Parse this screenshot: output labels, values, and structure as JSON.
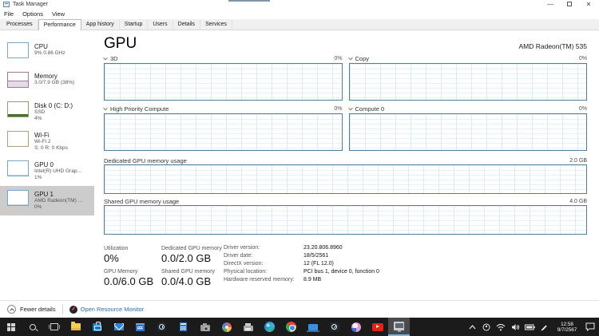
{
  "colors": {
    "accent_link": "#2b6cb5",
    "chart_border": "#4f7e99",
    "taskbar_bg": "#1b1b1b",
    "selected_sidebar_bg": "#cccccc",
    "active_app_underline": "#76b9ed"
  },
  "window": {
    "title": "Task Manager",
    "minimize": "—",
    "maximize": "",
    "close": "✕"
  },
  "menu": {
    "items": [
      {
        "label": "File"
      },
      {
        "label": "Options"
      },
      {
        "label": "View"
      }
    ]
  },
  "tabs": {
    "items": [
      {
        "label": "Processes"
      },
      {
        "label": "Performance"
      },
      {
        "label": "App history"
      },
      {
        "label": "Startup"
      },
      {
        "label": "Users"
      },
      {
        "label": "Details"
      },
      {
        "label": "Services"
      }
    ],
    "active": "Performance"
  },
  "sidebar": {
    "items": [
      {
        "title": "CPU",
        "line1": "9% 0.86 GHz"
      },
      {
        "title": "Memory",
        "line1": "3.0/7.9 GB (38%)"
      },
      {
        "title": "Disk 0 (C: D:)",
        "line1": "SSD",
        "line2": "4%"
      },
      {
        "title": "Wi-Fi",
        "line1": "Wi-Fi 2",
        "line2": "S: 0 R: 0 Kbps"
      },
      {
        "title": "GPU 0",
        "line1": "Intel(R) UHD Grap...",
        "line2": "1%"
      },
      {
        "title": "GPU 1",
        "line1": "AMD Radeon(TM) ...",
        "line2": "0%",
        "selected": true
      }
    ]
  },
  "main": {
    "title": "GPU",
    "subtitle": "AMD Radeon(TM) 535",
    "charts": [
      {
        "label": "3D",
        "value": "0%"
      },
      {
        "label": "Copy",
        "value": "0%"
      },
      {
        "label": "High Priority Compute",
        "value": "0%"
      },
      {
        "label": "Compute 0",
        "value": "0%"
      },
      {
        "label": "Dedicated GPU memory usage",
        "value": "2.0 GB"
      },
      {
        "label": "Shared GPU memory usage",
        "value": "4.0 GB"
      }
    ],
    "stats": {
      "utilization_label": "Utilization",
      "utilization_value": "0%",
      "dedicated_label": "Dedicated GPU memory",
      "dedicated_value": "0.0/2.0 GB",
      "gpu_memory_label": "GPU Memory",
      "gpu_memory_value": "0.0/6.0 GB",
      "shared_label": "Shared GPU memory",
      "shared_value": "0.0/4.0 GB",
      "details": [
        {
          "label": "Driver version:",
          "value": "23.20.806.8960"
        },
        {
          "label": "Driver date:",
          "value": "18/5/2561"
        },
        {
          "label": "DirectX version:",
          "value": "12 (FL 12.0)"
        },
        {
          "label": "Physical location:",
          "value": "PCI bus 1, device 0, function 0"
        },
        {
          "label": "Hardware reserved memory:",
          "value": "8.9 MB"
        }
      ]
    }
  },
  "footer": {
    "fewer_details": "Fewer details",
    "resource_monitor": "Open Resource Monitor"
  },
  "taskbar": {
    "icons": [
      "start",
      "search",
      "task-view",
      "file-explorer",
      "store",
      "mail",
      "calendar",
      "alarms",
      "calculator",
      "camera",
      "paint",
      "fax",
      "edge",
      "chrome",
      "laptop",
      "gauge",
      "paint-3d",
      "youtube",
      "task-manager"
    ],
    "active_app": "task-manager",
    "tray_icons": [
      "chevron-up",
      "status",
      "wifi",
      "volume",
      "battery",
      "pen",
      "action-center"
    ],
    "clock_time": "12:58",
    "clock_date": "9/7/2567"
  }
}
